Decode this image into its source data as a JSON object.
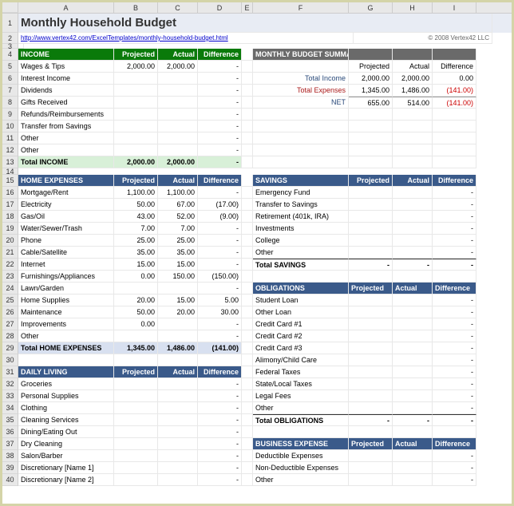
{
  "title": "Monthly Household Budget",
  "link": "http://www.vertex42.com/ExcelTemplates/monthly-household-budget.html",
  "copyright": "© 2008 Vertex42 LLC",
  "cols": [
    "A",
    "B",
    "C",
    "D",
    "E",
    "F",
    "G",
    "H",
    "I"
  ],
  "h": {
    "proj": "Projected",
    "act": "Actual",
    "diff": "Difference"
  },
  "income": {
    "label": "INCOME",
    "rows": [
      {
        "n": "Wages & Tips",
        "p": "2,000.00",
        "a": "2,000.00",
        "d": "-"
      },
      {
        "n": "Interest Income",
        "p": "",
        "a": "",
        "d": "-"
      },
      {
        "n": "Dividends",
        "p": "",
        "a": "",
        "d": "-"
      },
      {
        "n": "Gifts Received",
        "p": "",
        "a": "",
        "d": "-"
      },
      {
        "n": "Refunds/Reimbursements",
        "p": "",
        "a": "",
        "d": "-"
      },
      {
        "n": "Transfer from Savings",
        "p": "",
        "a": "",
        "d": "-"
      },
      {
        "n": "Other",
        "p": "",
        "a": "",
        "d": "-"
      },
      {
        "n": "Other",
        "p": "",
        "a": "",
        "d": "-"
      }
    ],
    "total": {
      "n": "Total INCOME",
      "p": "2,000.00",
      "a": "2,000.00",
      "d": "-"
    }
  },
  "summary": {
    "label": "MONTHLY BUDGET SUMMARY",
    "rows": [
      {
        "n": "Total Income",
        "p": "2,000.00",
        "a": "2,000.00",
        "d": "0.00",
        "cls": ""
      },
      {
        "n": "Total Expenses",
        "p": "1,345.00",
        "a": "1,486.00",
        "d": "(141.00)",
        "cls": "red"
      }
    ],
    "net": {
      "n": "NET",
      "p": "655.00",
      "a": "514.00",
      "d": "(141.00)"
    }
  },
  "home": {
    "label": "HOME EXPENSES",
    "rows": [
      {
        "n": "Mortgage/Rent",
        "p": "1,100.00",
        "a": "1,100.00",
        "d": "-"
      },
      {
        "n": "Electricity",
        "p": "50.00",
        "a": "67.00",
        "d": "(17.00)"
      },
      {
        "n": "Gas/Oil",
        "p": "43.00",
        "a": "52.00",
        "d": "(9.00)"
      },
      {
        "n": "Water/Sewer/Trash",
        "p": "7.00",
        "a": "7.00",
        "d": "-"
      },
      {
        "n": "Phone",
        "p": "25.00",
        "a": "25.00",
        "d": "-"
      },
      {
        "n": "Cable/Satellite",
        "p": "35.00",
        "a": "35.00",
        "d": "-"
      },
      {
        "n": "Internet",
        "p": "15.00",
        "a": "15.00",
        "d": "-"
      },
      {
        "n": "Furnishings/Appliances",
        "p": "0.00",
        "a": "150.00",
        "d": "(150.00)"
      },
      {
        "n": "Lawn/Garden",
        "p": "",
        "a": "",
        "d": "-"
      },
      {
        "n": "Home Supplies",
        "p": "20.00",
        "a": "15.00",
        "d": "5.00"
      },
      {
        "n": "Maintenance",
        "p": "50.00",
        "a": "20.00",
        "d": "30.00"
      },
      {
        "n": "Improvements",
        "p": "0.00",
        "a": "",
        "d": "-"
      },
      {
        "n": "Other",
        "p": "",
        "a": "",
        "d": "-"
      }
    ],
    "total": {
      "n": "Total HOME EXPENSES",
      "p": "1,345.00",
      "a": "1,486.00",
      "d": "(141.00)"
    }
  },
  "savings": {
    "label": "SAVINGS",
    "rows": [
      {
        "n": "Emergency Fund",
        "p": "",
        "a": "",
        "d": "-"
      },
      {
        "n": "Transfer to Savings",
        "p": "",
        "a": "",
        "d": "-"
      },
      {
        "n": "Retirement (401k, IRA)",
        "p": "",
        "a": "",
        "d": "-"
      },
      {
        "n": "Investments",
        "p": "",
        "a": "",
        "d": "-"
      },
      {
        "n": "College",
        "p": "",
        "a": "",
        "d": "-"
      },
      {
        "n": "Other",
        "p": "",
        "a": "",
        "d": "-"
      }
    ],
    "total": {
      "n": "Total SAVINGS",
      "p": "-",
      "a": "-",
      "d": "-"
    }
  },
  "obligations": {
    "label": "OBLIGATIONS",
    "rows": [
      {
        "n": "Student Loan",
        "p": "",
        "a": "",
        "d": "-"
      },
      {
        "n": "Other Loan",
        "p": "",
        "a": "",
        "d": "-"
      },
      {
        "n": "Credit Card #1",
        "p": "",
        "a": "",
        "d": "-"
      },
      {
        "n": "Credit Card #2",
        "p": "",
        "a": "",
        "d": "-"
      },
      {
        "n": "Credit Card #3",
        "p": "",
        "a": "",
        "d": "-"
      },
      {
        "n": "Alimony/Child Care",
        "p": "",
        "a": "",
        "d": "-"
      },
      {
        "n": "Federal Taxes",
        "p": "",
        "a": "",
        "d": "-"
      },
      {
        "n": "State/Local Taxes",
        "p": "",
        "a": "",
        "d": "-"
      },
      {
        "n": "Legal Fees",
        "p": "",
        "a": "",
        "d": "-"
      },
      {
        "n": "Other",
        "p": "",
        "a": "",
        "d": "-"
      }
    ],
    "total": {
      "n": "Total OBLIGATIONS",
      "p": "-",
      "a": "-",
      "d": "-"
    }
  },
  "daily": {
    "label": "DAILY LIVING",
    "rows": [
      {
        "n": "Groceries",
        "p": "",
        "a": "",
        "d": "-"
      },
      {
        "n": "Personal Supplies",
        "p": "",
        "a": "",
        "d": "-"
      },
      {
        "n": "Clothing",
        "p": "",
        "a": "",
        "d": "-"
      },
      {
        "n": "Cleaning Services",
        "p": "",
        "a": "",
        "d": "-"
      },
      {
        "n": "Dining/Eating Out",
        "p": "",
        "a": "",
        "d": "-"
      },
      {
        "n": "Dry Cleaning",
        "p": "",
        "a": "",
        "d": "-"
      },
      {
        "n": "Salon/Barber",
        "p": "",
        "a": "",
        "d": "-"
      },
      {
        "n": "Discretionary [Name 1]",
        "p": "",
        "a": "",
        "d": "-"
      },
      {
        "n": "Discretionary [Name 2]",
        "p": "",
        "a": "",
        "d": "-"
      }
    ]
  },
  "business": {
    "label": "BUSINESS EXPENSE",
    "rows": [
      {
        "n": "Deductible Expenses",
        "p": "",
        "a": "",
        "d": "-"
      },
      {
        "n": "Non-Deductible Expenses",
        "p": "",
        "a": "",
        "d": "-"
      },
      {
        "n": "Other",
        "p": "",
        "a": "",
        "d": "-"
      }
    ]
  }
}
